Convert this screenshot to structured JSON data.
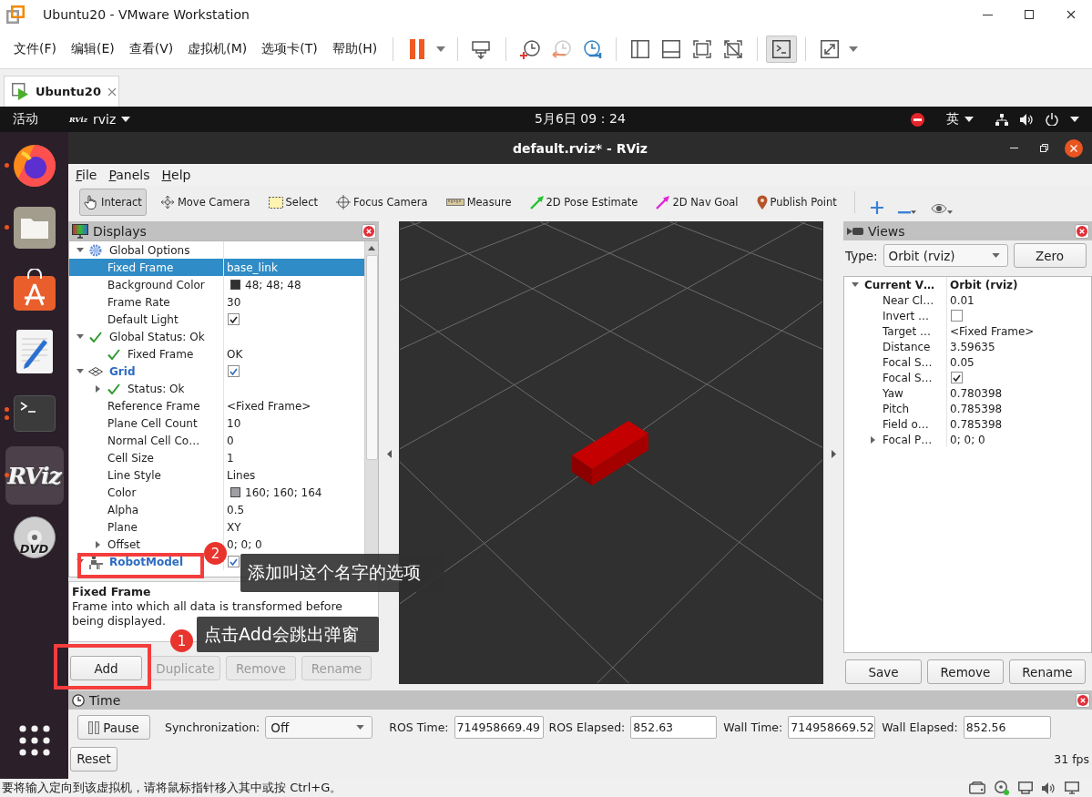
{
  "vmware": {
    "title": "Ubuntu20 - VMware Workstation",
    "menus": [
      "文件(F)",
      "编辑(E)",
      "查看(V)",
      "虚拟机(M)",
      "选项卡(T)",
      "帮助(H)"
    ],
    "console_view_active": true,
    "tabs": [
      {
        "label": "Ubuntu20",
        "selected": true
      }
    ],
    "status_text": "要将输入定向到该虚拟机，请将鼠标指针移入其中或按 Ctrl+G。"
  },
  "ubuntu_top_bar": {
    "activities": "活动",
    "app_menu": {
      "logo_text": "RViz",
      "label": "rviz"
    },
    "clock": "5月6日 09：24",
    "input_method": "英"
  },
  "dock": {
    "items": [
      {
        "running": true,
        "active": false
      },
      {
        "running": true,
        "active": false
      },
      {
        "running": false,
        "active": false
      },
      {
        "running": false,
        "active": false
      },
      {
        "running": true,
        "multiple_windows": true,
        "active": false
      },
      {
        "logo_text": "RViz",
        "running": true,
        "active": true
      },
      {
        "logo_text": "DVD",
        "running": false,
        "active": false
      }
    ]
  },
  "rviz": {
    "title": "default.rviz* - RViz",
    "menus": [
      "File",
      "Panels",
      "Help"
    ],
    "tools": [
      {
        "label": "Interact",
        "selected": true
      },
      {
        "label": "Move Camera",
        "selected": false
      },
      {
        "label": "Select",
        "selected": false
      },
      {
        "label": "Focus Camera",
        "selected": false
      },
      {
        "label": "Measure",
        "selected": false
      },
      {
        "label": "2D Pose Estimate",
        "selected": false
      },
      {
        "label": "2D Nav Goal",
        "selected": false
      },
      {
        "label": "Publish Point",
        "selected": false
      }
    ],
    "displays": {
      "title": "Displays",
      "tree": [
        {
          "label": "Global Options",
          "kind": "options",
          "expanded": true,
          "selected": false,
          "children": [
            {
              "label": "Fixed Frame",
              "kind": "property",
              "value": "base_link",
              "selected": true
            },
            {
              "label": "Background Color",
              "kind": "property",
              "value": {
                "kind": "color",
                "text": "48; 48; 48"
              },
              "selected": false
            },
            {
              "label": "Frame Rate",
              "kind": "property",
              "value": "30",
              "selected": false
            },
            {
              "label": "Default Light",
              "kind": "property",
              "value": {
                "kind": "checkbox",
                "checked": true
              },
              "selected": false
            }
          ]
        },
        {
          "label": "Global Status: Ok",
          "kind": "status",
          "expanded": true,
          "selected": false,
          "children": [
            {
              "label": "Fixed Frame",
              "kind": "status",
              "value": "OK",
              "selected": false
            }
          ]
        },
        {
          "label": "Grid",
          "kind": "grid",
          "value": {
            "kind": "checkbox",
            "checked": true
          },
          "expanded": true,
          "selected": false,
          "children": [
            {
              "label": "Status: Ok",
              "kind": "status",
              "expanded": false,
              "selected": false
            },
            {
              "label": "Reference Frame",
              "kind": "property",
              "value": "<Fixed Frame>",
              "selected": false
            },
            {
              "label": "Plane Cell Count",
              "kind": "property",
              "value": "10",
              "selected": false
            },
            {
              "label": "Normal Cell Co…",
              "kind": "property",
              "value": "0",
              "selected": false
            },
            {
              "label": "Cell Size",
              "kind": "property",
              "value": "1",
              "selected": false
            },
            {
              "label": "Line Style",
              "kind": "property",
              "value": "Lines",
              "selected": false
            },
            {
              "label": "Color",
              "kind": "property",
              "value": {
                "kind": "color",
                "text": "160; 160; 164"
              },
              "selected": false
            },
            {
              "label": "Alpha",
              "kind": "property",
              "value": "0.5",
              "selected": false
            },
            {
              "label": "Plane",
              "kind": "property",
              "value": "XY",
              "selected": false
            },
            {
              "label": "Offset",
              "kind": "property",
              "value": "0; 0; 0",
              "expanded": false,
              "selected": false
            }
          ]
        },
        {
          "label": "RobotModel",
          "kind": "robot",
          "value": {
            "kind": "checkbox",
            "checked": true
          },
          "expanded": true,
          "selected": false
        }
      ],
      "description": {
        "title": "Fixed Frame",
        "text": "Frame into which all data is transformed before being displayed."
      },
      "buttons": [
        {
          "label": "Add",
          "disabled": false
        },
        {
          "label": "Duplicate",
          "disabled": true
        },
        {
          "label": "Remove",
          "disabled": true
        },
        {
          "label": "Rename",
          "disabled": true
        }
      ]
    },
    "views": {
      "title": "Views",
      "type_label": "Type:",
      "type_value": "Orbit (rviz)",
      "zero_button": "Zero",
      "tree": [
        {
          "label": "Current V…",
          "kind": "category",
          "value": "Orbit (rviz)",
          "expanded": true,
          "selected": false,
          "children": [
            {
              "label": "Near Cl…",
              "kind": "property",
              "value": "0.01",
              "selected": false
            },
            {
              "label": "Invert …",
              "kind": "property",
              "value": {
                "kind": "checkbox",
                "checked": false
              },
              "selected": false
            },
            {
              "label": "Target …",
              "kind": "property",
              "value": "<Fixed Frame>",
              "selected": false
            },
            {
              "label": "Distance",
              "kind": "property",
              "value": "3.59635",
              "selected": false
            },
            {
              "label": "Focal S…",
              "kind": "property",
              "value": "0.05",
              "selected": false
            },
            {
              "label": "Focal S…",
              "kind": "property",
              "value": {
                "kind": "checkbox",
                "checked": true
              },
              "selected": false
            },
            {
              "label": "Yaw",
              "kind": "property",
              "value": "0.780398",
              "selected": false
            },
            {
              "label": "Pitch",
              "kind": "property",
              "value": "0.785398",
              "selected": false
            },
            {
              "label": "Field o…",
              "kind": "property",
              "value": "0.785398",
              "selected": false
            },
            {
              "label": "Focal P…",
              "kind": "property",
              "value": "0; 0; 0",
              "expanded": false,
              "selected": false
            }
          ]
        }
      ],
      "buttons": [
        "Save",
        "Remove",
        "Rename"
      ]
    },
    "time": {
      "title": "Time",
      "pause_button": "Pause",
      "sync_label": "Synchronization:",
      "sync_value": "Off",
      "fields": [
        {
          "label": "ROS Time:",
          "value": "714958669.49"
        },
        {
          "label": "ROS Elapsed:",
          "value": "852.63"
        },
        {
          "label": "Wall Time:",
          "value": "714958669.52"
        },
        {
          "label": "Wall Elapsed:",
          "value": "852.56"
        }
      ],
      "reset_button": "Reset",
      "fps": "31 fps"
    }
  },
  "annotations": [
    {
      "number": "2",
      "text": "添加叫这个名字的选项"
    },
    {
      "number": "1",
      "text": "点击Add会跳出弹窗"
    }
  ]
}
